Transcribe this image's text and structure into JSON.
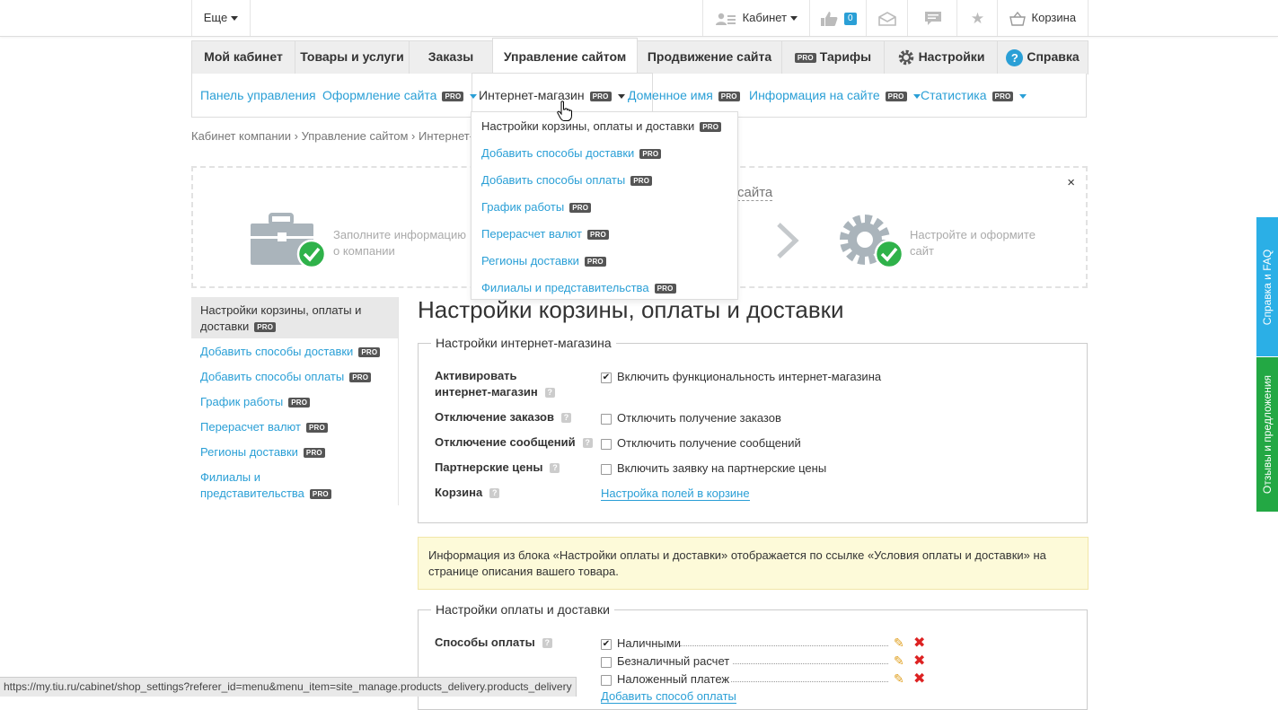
{
  "topbar": {
    "more_label": "Еще",
    "cabinet_label": "Кабинет",
    "likes_count": "0",
    "cart_label": "Корзина"
  },
  "tabs": [
    {
      "label": "Мой кабинет"
    },
    {
      "label": "Товары и услуги"
    },
    {
      "label": "Заказы"
    },
    {
      "label": "Управление сайтом"
    },
    {
      "label": "Продвижение сайта"
    },
    {
      "label": "Тарифы",
      "pro": "PRO"
    },
    {
      "label": "Настройки"
    },
    {
      "label": "Справка"
    }
  ],
  "subnav": [
    {
      "label": "Панель управления"
    },
    {
      "label": "Оформление сайта",
      "pro": "PRO"
    },
    {
      "label": "Интернет-магазин",
      "pro": "PRO"
    },
    {
      "label": "Доменное имя",
      "pro": "PRO"
    },
    {
      "label": "Информация на сайте",
      "pro": "PRO"
    },
    {
      "label": "Статистика",
      "pro": "PRO"
    }
  ],
  "dropdown": [
    {
      "label": "Настройки корзины, оплаты и доставки",
      "pro": "PRO"
    },
    {
      "label": "Добавить способы доставки",
      "pro": "PRO"
    },
    {
      "label": "Добавить способы оплаты",
      "pro": "PRO"
    },
    {
      "label": "График работы",
      "pro": "PRO"
    },
    {
      "label": "Перерасчет валют",
      "pro": "PRO"
    },
    {
      "label": "Регионы доставки",
      "pro": "PRO"
    },
    {
      "label": "Филиалы и представительства",
      "pro": "PRO"
    }
  ],
  "breadcrumb": "Кабинет компании › Управление сайтом › Интернет-м",
  "banner": {
    "title_fragment": "сайта",
    "step1": "Заполните информацию о компании",
    "step2": "Настройте и оформите сайт",
    "close": "×"
  },
  "sidebar": [
    {
      "label": "Настройки корзины, оплаты и доставки",
      "pro": "PRO"
    },
    {
      "label": "Добавить способы доставки",
      "pro": "PRO"
    },
    {
      "label": "Добавить способы оплаты",
      "pro": "PRO"
    },
    {
      "label": "График работы",
      "pro": "PRO"
    },
    {
      "label": "Перерасчет валют",
      "pro": "PRO"
    },
    {
      "label": "Регионы доставки",
      "pro": "PRO"
    },
    {
      "label": "Филиалы и представительства",
      "pro": "PRO"
    }
  ],
  "page_title": "Настройки корзины, оплаты и доставки",
  "shop_settings": {
    "legend": "Настройки интернет-магазина",
    "rows": [
      {
        "label": "Активировать интернет-магазин",
        "option": "Включить функциональность интернет-магазина",
        "checked": true
      },
      {
        "label": "Отключение заказов",
        "option": "Отключить получение заказов",
        "checked": false
      },
      {
        "label": "Отключение сообщений",
        "option": "Отключить получение сообщений",
        "checked": false
      },
      {
        "label": "Партнерские цены",
        "option": "Включить заявку на партнерские цены",
        "checked": false
      },
      {
        "label": "Корзина",
        "link": "Настройка полей в корзине"
      }
    ]
  },
  "info_text": "Информация из блока «Настройки оплаты и доставки» отображается по ссылке «Условия оплаты и доставки» на странице описания вашего товара.",
  "payment": {
    "legend": "Настройки оплаты и доставки",
    "label": "Способы оплаты",
    "methods": [
      {
        "name": "Наличными",
        "checked": true
      },
      {
        "name": "Безналичный расчет",
        "checked": false
      },
      {
        "name": "Наложенный платеж",
        "checked": false
      }
    ],
    "add_link": "Добавить способ оплаты"
  },
  "side_tabs": {
    "help": "Справка и FAQ",
    "feedback": "Отзывы и предложения"
  },
  "status_url": "https://my.tiu.ru/cabinet/shop_settings?referer_id=menu&menu_item=site_manage.products_delivery.products_delivery",
  "colors": {
    "link": "#2a9fd6",
    "pro_badge": "#555555",
    "info_bg": "#fdfad9",
    "help_tab": "#2bafe6",
    "feedback_tab": "#23a844",
    "check_green": "#2fb24a"
  }
}
